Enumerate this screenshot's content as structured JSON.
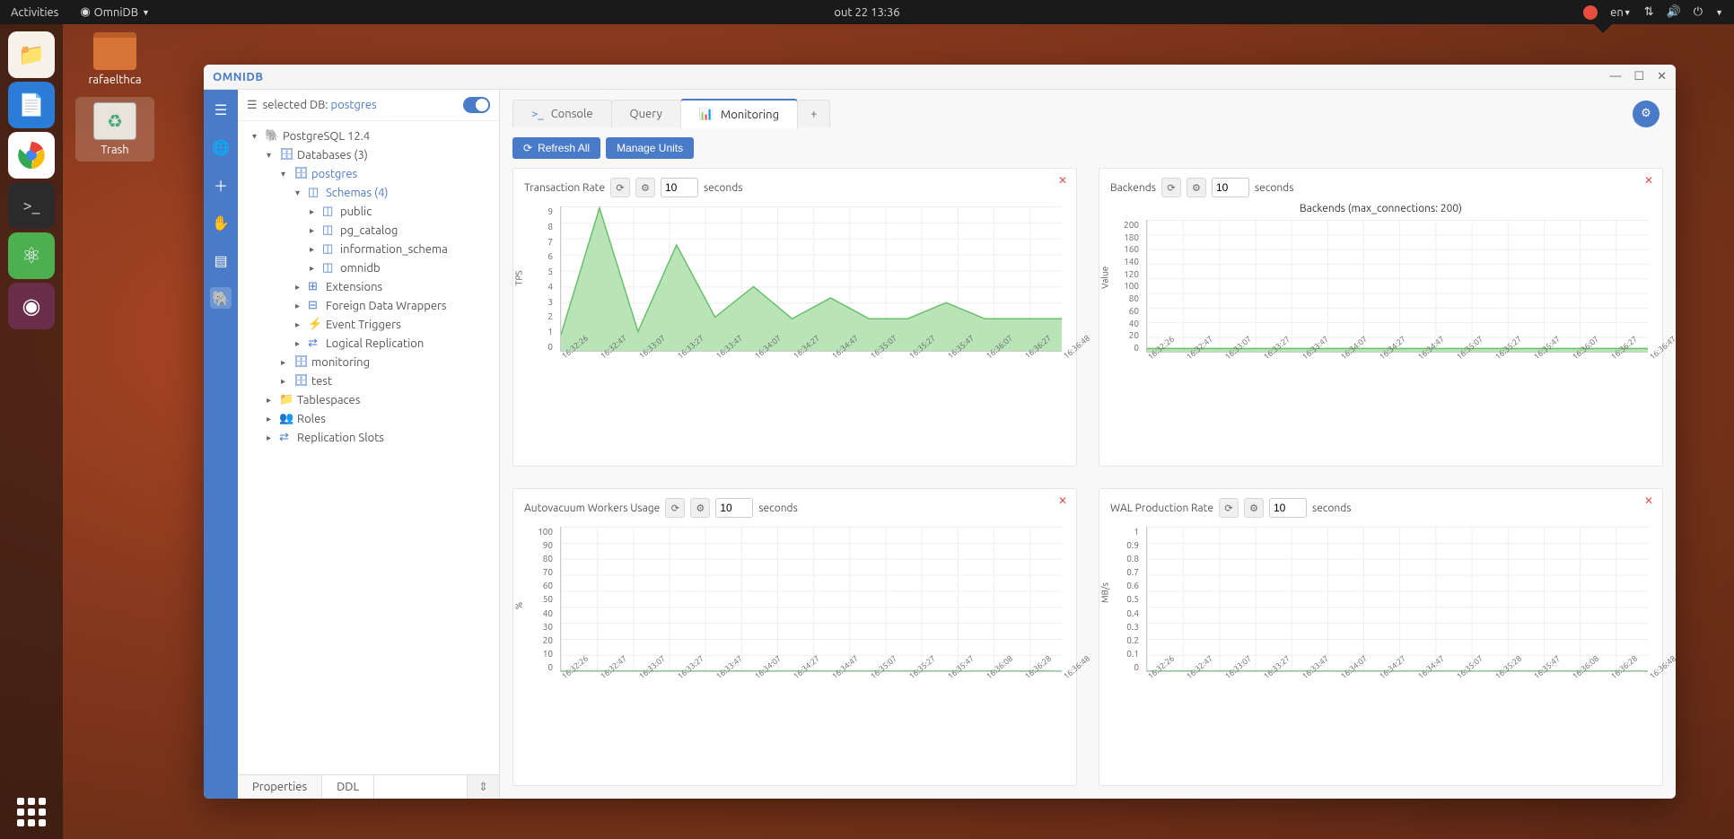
{
  "topbar": {
    "activities": "Activities",
    "app": "OmniDB",
    "clock": "out 22  13:36",
    "lang": "en"
  },
  "desktop": {
    "folder": "rafaelthca",
    "trash": "Trash"
  },
  "window": {
    "title": "OMNIDB"
  },
  "sidebar": {
    "selected_prefix": "selected DB:",
    "selected_db": "postgres",
    "root": "PostgreSQL 12.4",
    "databases": "Databases (3)",
    "postgres": "postgres",
    "schemas": "Schemas (4)",
    "schema_public": "public",
    "schema_pg_catalog": "pg_catalog",
    "schema_info": "information_schema",
    "schema_omnidb": "omnidb",
    "extensions": "Extensions",
    "fdw": "Foreign Data Wrappers",
    "event_triggers": "Event Triggers",
    "logical_repl": "Logical Replication",
    "monitoring": "monitoring",
    "test": "test",
    "tablespaces": "Tablespaces",
    "roles": "Roles",
    "repl_slots": "Replication Slots",
    "tab_properties": "Properties",
    "tab_ddl": "DDL"
  },
  "tabs": {
    "console": "Console",
    "query": "Query",
    "monitoring": "Monitoring"
  },
  "toolbar": {
    "refresh": "Refresh All",
    "manage": "Manage Units"
  },
  "cards": {
    "transaction": {
      "title": "Transaction Rate",
      "interval": "10",
      "unit": "seconds",
      "ylabel": "TPS"
    },
    "backends": {
      "title": "Backends",
      "interval": "10",
      "unit": "seconds",
      "chart_title": "Backends (max_connections: 200)",
      "ylabel": "Value"
    },
    "autovacuum": {
      "title": "Autovacuum Workers Usage",
      "interval": "10",
      "unit": "seconds",
      "ylabel": "%"
    },
    "wal": {
      "title": "WAL Production Rate",
      "interval": "10",
      "unit": "seconds",
      "ylabel": "MB/s"
    }
  },
  "chart_data": [
    {
      "id": "transaction",
      "type": "area",
      "xlabel": "",
      "ylabel": "TPS",
      "ylim": [
        0,
        9
      ],
      "x": [
        "16:32:26",
        "16:32:47",
        "16:33:07",
        "16:33:27",
        "16:33:47",
        "16:34:07",
        "16:34:27",
        "16:34:47",
        "16:35:07",
        "16:35:27",
        "16:35:47",
        "16:36:07",
        "16:36:27",
        "16:36:48"
      ],
      "values": [
        1.0,
        8.9,
        1.2,
        6.6,
        2.1,
        4.0,
        2.0,
        3.3,
        2.0,
        2.0,
        3.0,
        2.0,
        2.0,
        2.0
      ],
      "yticks": [
        0,
        1,
        2,
        3,
        4,
        5,
        6,
        7,
        8,
        9
      ]
    },
    {
      "id": "backends",
      "type": "area",
      "title": "Backends (max_connections: 200)",
      "xlabel": "",
      "ylabel": "Value",
      "ylim": [
        0,
        200
      ],
      "x": [
        "16:32:26",
        "16:32:47",
        "16:33:07",
        "16:33:27",
        "16:33:47",
        "16:34:07",
        "16:34:27",
        "16:34:47",
        "16:35:07",
        "16:35:27",
        "16:35:47",
        "16:36:07",
        "16:36:27",
        "16:36:47"
      ],
      "values": [
        5,
        5,
        5,
        5,
        5,
        5,
        5,
        5,
        5,
        5,
        5,
        5,
        5,
        5
      ],
      "yticks": [
        0,
        20,
        40,
        60,
        80,
        100,
        120,
        140,
        160,
        180,
        200
      ]
    },
    {
      "id": "autovacuum",
      "type": "line",
      "xlabel": "",
      "ylabel": "%",
      "ylim": [
        0,
        100
      ],
      "x": [
        "16:32:26",
        "16:32:47",
        "16:33:07",
        "16:33:27",
        "16:33:47",
        "16:34:07",
        "16:34:27",
        "16:34:47",
        "16:35:07",
        "16:35:27",
        "16:35:47",
        "16:36:08",
        "16:36:28",
        "16:36:48"
      ],
      "values": [
        0,
        0,
        0,
        0,
        0,
        0,
        0,
        0,
        0,
        0,
        0,
        0,
        0,
        0
      ],
      "yticks": [
        0,
        10,
        20,
        30,
        40,
        50,
        60,
        70,
        80,
        90,
        100
      ]
    },
    {
      "id": "wal",
      "type": "line",
      "xlabel": "",
      "ylabel": "MB/s",
      "ylim": [
        0,
        1.0
      ],
      "x": [
        "16:32:26",
        "16:32:47",
        "16:33:07",
        "16:33:27",
        "16:33:47",
        "16:34:07",
        "16:34:27",
        "16:34:47",
        "16:35:07",
        "16:35:28",
        "16:35:47",
        "16:36:08",
        "16:36:28",
        "16:36:48"
      ],
      "values": [
        0,
        0,
        0,
        0,
        0,
        0,
        0,
        0,
        0,
        0,
        0,
        0,
        0,
        0
      ],
      "yticks": [
        0,
        0.1,
        0.2,
        0.3,
        0.4,
        0.5,
        0.6,
        0.7,
        0.8,
        0.9,
        1.0
      ]
    }
  ]
}
